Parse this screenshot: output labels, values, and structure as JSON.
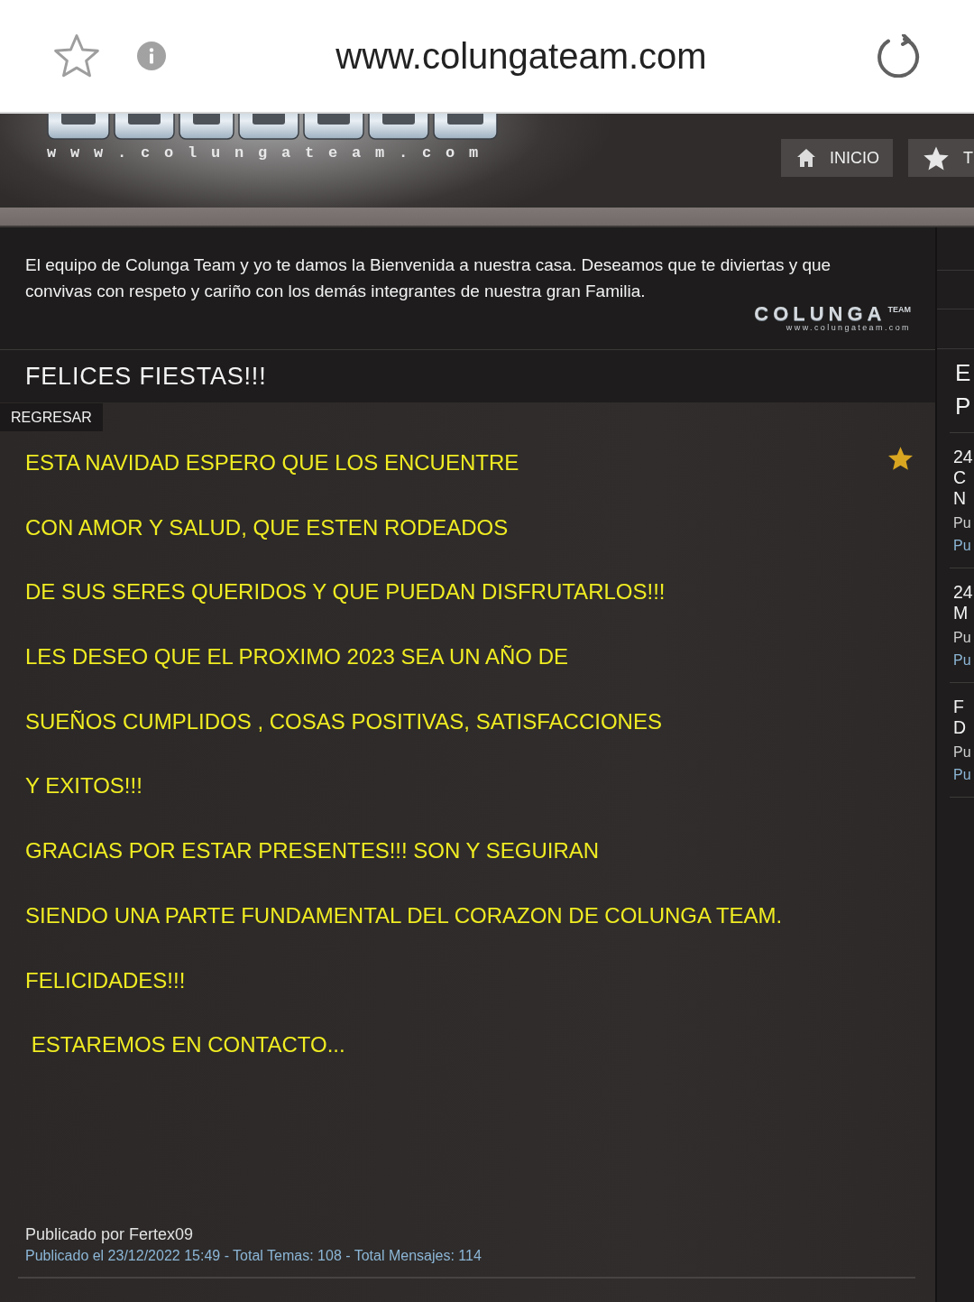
{
  "browser_bar": {
    "url": "www.colungateam.com"
  },
  "site_header": {
    "logo_tagline": "www.colungateam.com",
    "nav": [
      {
        "kind": "home",
        "label": "INICIO"
      },
      {
        "kind": "star",
        "label": "T"
      }
    ]
  },
  "welcome": {
    "text": "El equipo de Colunga Team y yo te damos la Bienvenida a nuestra casa. Deseamos que te diviertas y que convivas con respeto y cariño con los demás integrantes de nuestra gran Familia.",
    "logo": {
      "wordmark": "COLUNGA",
      "badge": "TEAM",
      "tagline": "www.colungateam.com"
    }
  },
  "post": {
    "title": "FELICES FIESTAS!!!",
    "back_button": "REGRESAR",
    "starred": true,
    "lines": [
      "ESTA NAVIDAD ESPERO QUE LOS ENCUENTRE",
      "CON AMOR Y SALUD, QUE ESTEN RODEADOS",
      "DE SUS SERES QUERIDOS Y QUE PUEDAN DISFRUTARLOS!!!",
      "LES DESEO QUE EL PROXIMO 2023 SEA UN AÑO DE",
      "SUEÑOS CUMPLIDOS , COSAS POSITIVAS, SATISFACCIONES",
      "Y EXITOS!!!",
      "GRACIAS POR ESTAR PRESENTES!!! SON Y SEGUIRAN",
      "SIENDO UNA PARTE FUNDAMENTAL DEL CORAZON DE COLUNGA TEAM.",
      "FELICIDADES!!!",
      " ESTAREMOS EN CONTACTO..."
    ],
    "author": "Publicado por Fertex09",
    "meta": "Publicado el 23/12/2022 15:49 - Total Temas: 108 - Total Mensajes: 114"
  },
  "sidebar": {
    "heading": [
      "E",
      "P"
    ],
    "posts": [
      {
        "title_lines": [
          "24",
          "C",
          "N"
        ],
        "author": "Pu",
        "meta": "Pu"
      },
      {
        "title_lines": [
          "24",
          "M"
        ],
        "author": "Pu",
        "meta": "Pu"
      },
      {
        "title_lines": [
          "F",
          "D"
        ],
        "author": "Pu",
        "meta": "Pu"
      }
    ]
  }
}
